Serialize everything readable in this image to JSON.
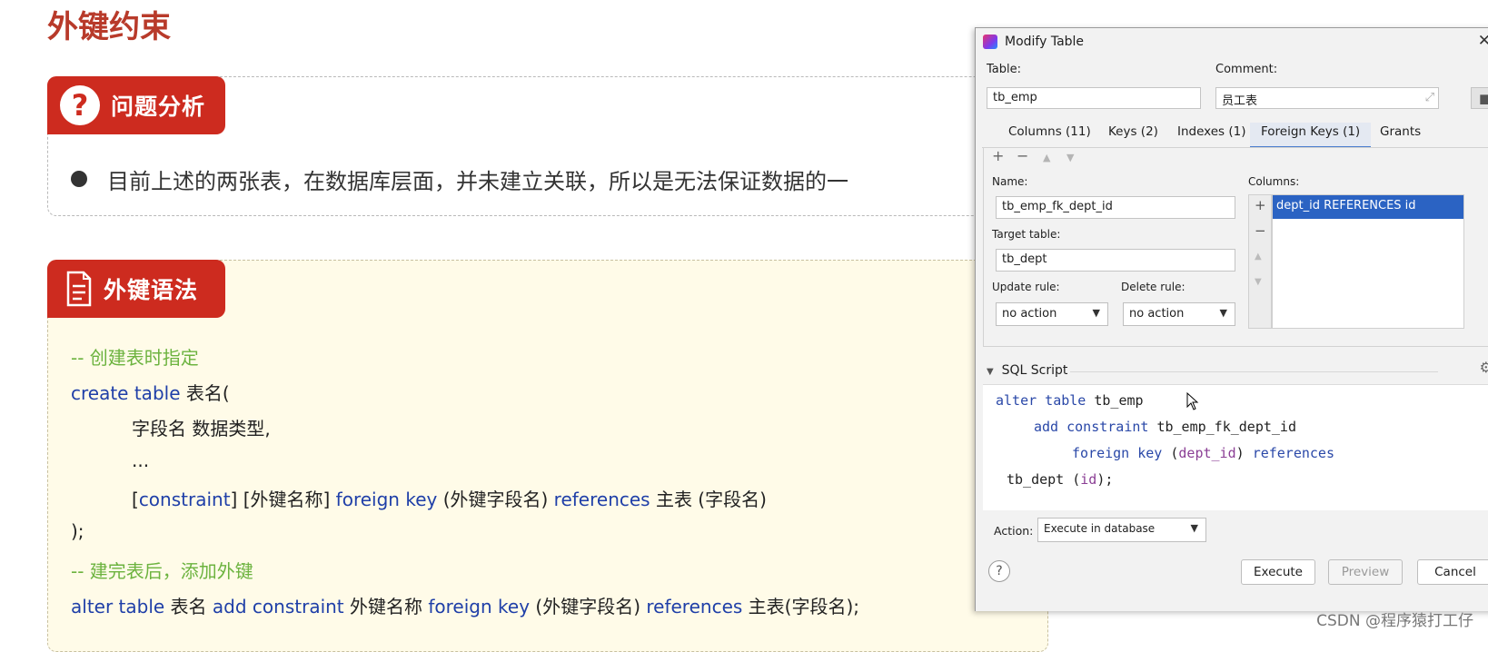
{
  "slide": {
    "title": "外键约束",
    "section1": {
      "label": "问题分析",
      "icon": "question-icon",
      "bullet": "目前上述的两张表，在数据库层面，并未建立关联，所以是无法保证数据的一"
    },
    "section2": {
      "label": "外键语法",
      "icon": "document-icon"
    },
    "code": {
      "c1": "-- 创建表时指定",
      "l1_kw": "create table",
      "l1_tx": " 表名(",
      "l2": "字段名    数据类型,",
      "l3": "...",
      "l4_a": "[",
      "l4_kw1": "constraint",
      "l4_b": "]   [外键名称]  ",
      "l4_kw2": "foreign  key",
      "l4_c": " (外键字段名)   ",
      "l4_kw3": "references",
      "l4_d": "   主表 (字段名)",
      "l5": ");",
      "c2": "-- 建完表后，添加外键",
      "l6_kw1": "alter table",
      "l6_a": "  表名  ",
      "l6_kw2": "add constraint",
      "l6_b": "  外键名称  ",
      "l6_kw3": "foreign key",
      "l6_c": " (外键字段名) ",
      "l6_kw4": "references",
      "l6_d": "  主表(字段名);"
    }
  },
  "dialog": {
    "title": "Modify Table",
    "table_label": "Table:",
    "table_value": "tb_emp",
    "comment_label": "Comment:",
    "comment_value": "员工表",
    "tabs": [
      {
        "label": "Columns (11)"
      },
      {
        "label": "Keys (2)"
      },
      {
        "label": "Indexes (1)"
      },
      {
        "label": "Foreign Keys (1)",
        "active": true
      },
      {
        "label": "Grants"
      }
    ],
    "toolbar": {
      "add": "+",
      "remove": "−",
      "up": "▲",
      "down": "▼"
    },
    "name_label": "Name:",
    "name_value": "tb_emp_fk_dept_id",
    "target_label": "Target table:",
    "target_value": "tb_dept",
    "update_label": "Update rule:",
    "update_value": "no action",
    "delete_label": "Delete rule:",
    "delete_value": "no action",
    "columns_label": "Columns:",
    "columns_row": "dept_id REFERENCES id",
    "sql_title": "SQL Script",
    "sql": {
      "l1a": "alter table",
      "l1b": " tb_emp",
      "l2a": "add constraint",
      "l2b": " tb_emp_fk_dept_id",
      "l3a": "foreign key",
      "l3b": " (",
      "l3c": "dept_id",
      "l3d": ") ",
      "l3e": "references",
      "l4a": "tb_dept (",
      "l4b": "id",
      "l4c": ");"
    },
    "action_label": "Action:",
    "action_value": "Execute in database",
    "buttons": {
      "execute": "Execute",
      "preview": "Preview",
      "cancel": "Cancel",
      "help": "?"
    }
  },
  "watermark": "CSDN @程序猿打工仔",
  "colors": {
    "accent": "#cd2b1f",
    "keyword": "#1f3fa8",
    "comment": "#6cb33f",
    "selection": "#2b63c3"
  }
}
